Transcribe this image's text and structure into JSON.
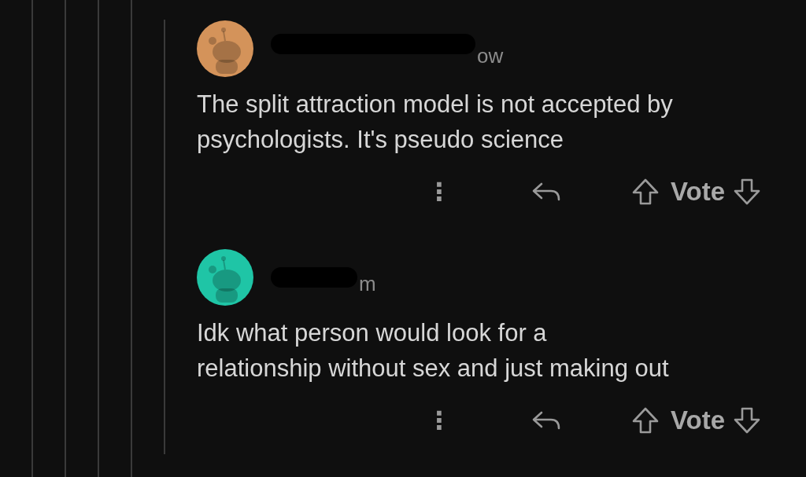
{
  "comments": [
    {
      "color": "#d4935a",
      "time": "ow",
      "body": "The split attraction model is not accepted by\npsychologists. It's pseudo science",
      "actions": {
        "more": "⋮",
        "vote": "Vote"
      }
    },
    {
      "color": "#1fc5a6",
      "time": "m",
      "body": "Idk what person would look for a\nrelationship without sex and just making out",
      "actions": {
        "more": "⋮",
        "vote": "Vote"
      }
    }
  ]
}
